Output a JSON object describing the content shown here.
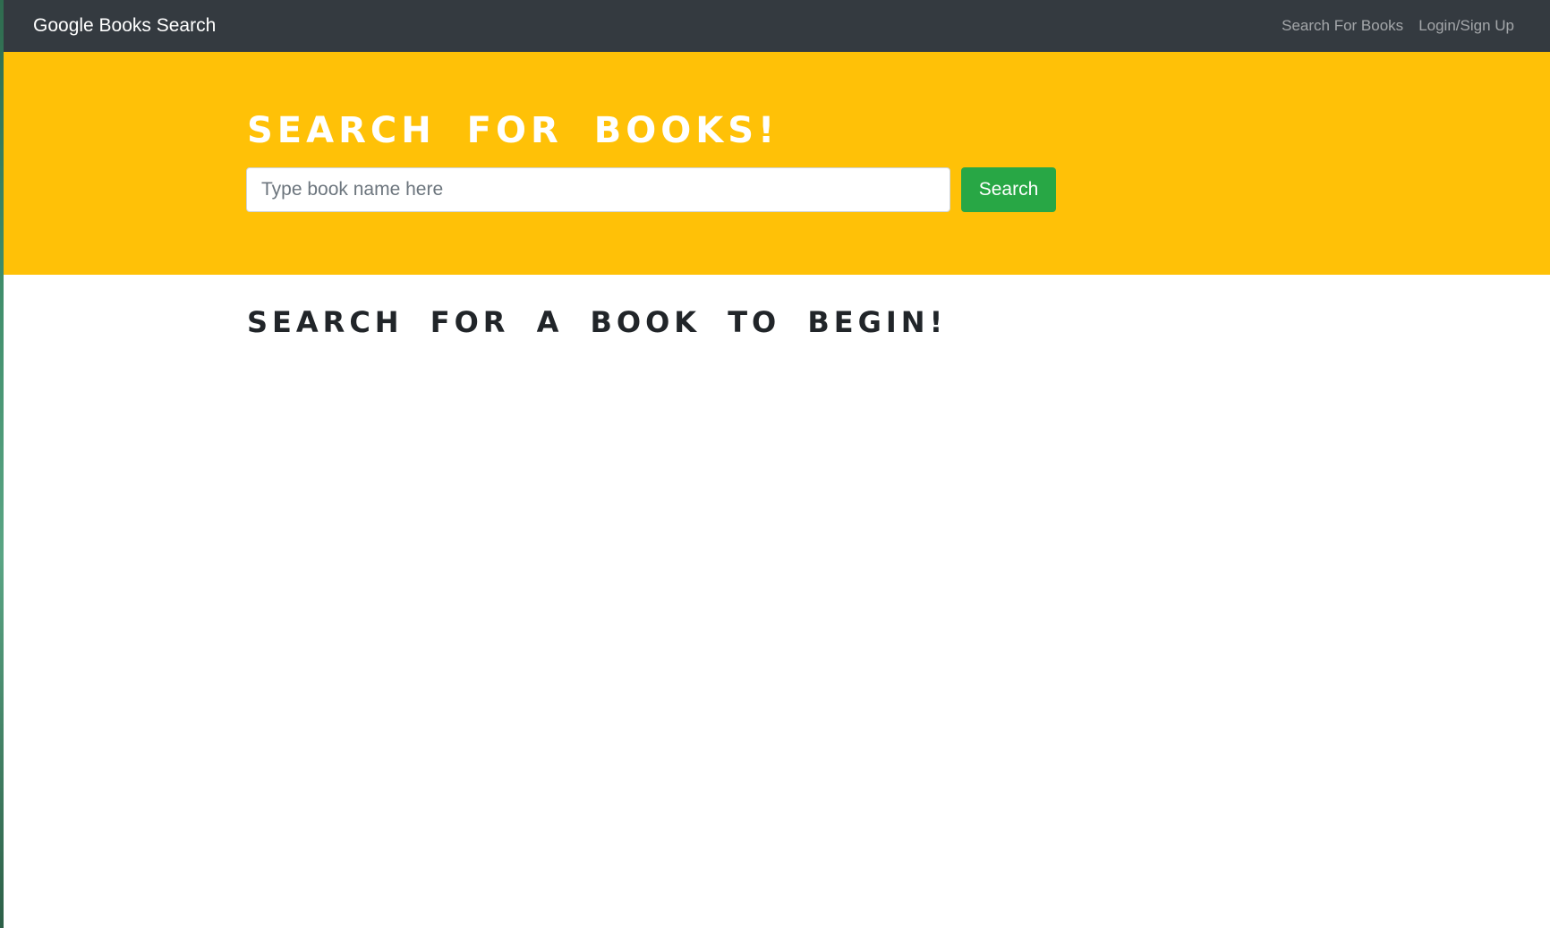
{
  "navbar": {
    "brand": "Google Books Search",
    "links": [
      {
        "label": "Search For Books"
      },
      {
        "label": "Login/Sign Up"
      }
    ]
  },
  "hero": {
    "title": "Search For Books!",
    "search": {
      "placeholder": "Type book name here",
      "value": "",
      "button_label": "Search"
    }
  },
  "main": {
    "status_heading": "Search for a book to begin!"
  },
  "colors": {
    "navbar_bg": "#343a40",
    "hero_bg": "#ffc107",
    "button_bg": "#28a745",
    "heading_text": "#212529"
  }
}
